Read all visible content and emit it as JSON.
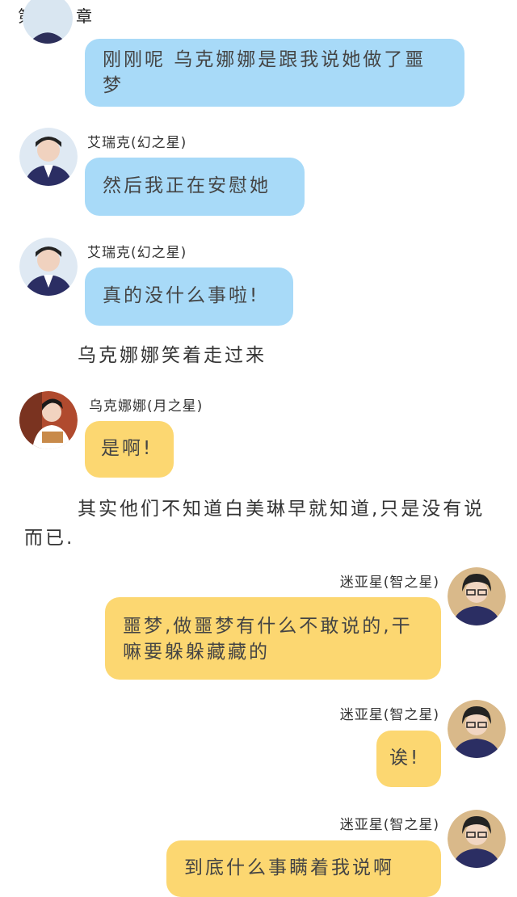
{
  "chapter_title": "第十三章",
  "messages": [
    {
      "speaker": "",
      "text": "刚刚呢 乌克娜娜是跟我说她做了噩梦",
      "color": "blue"
    },
    {
      "speaker": "艾瑞克(幻之星)",
      "text": "然后我正在安慰她",
      "color": "blue",
      "avatar": "avatar-eric"
    },
    {
      "speaker": "艾瑞克(幻之星)",
      "text": "真的没什么事啦!",
      "color": "blue",
      "avatar": "avatar-eric"
    },
    {
      "speaker": "乌克娜娜(月之星)",
      "text": "是啊!",
      "color": "yellow",
      "avatar": "avatar-ukenana"
    },
    {
      "speaker": "迷亚星(智之星)",
      "text": "噩梦,做噩梦有什么不敢说的,干嘛要躲躲藏藏的",
      "color": "yellow",
      "avatar": "avatar-miya"
    },
    {
      "speaker": "迷亚星(智之星)",
      "text": "诶!",
      "color": "yellow",
      "avatar": "avatar-miya"
    },
    {
      "speaker": "迷亚星(智之星)",
      "text": "到底什么事瞒着我说啊",
      "color": "yellow",
      "avatar": "avatar-miya"
    }
  ],
  "narration": [
    "乌克娜娜笑着走过来",
    "其实他们不知道白美琳早就知道,只是没有说而已."
  ],
  "colors": {
    "blue_bubble": "#a8daf8",
    "yellow_bubble": "#fcd771"
  }
}
